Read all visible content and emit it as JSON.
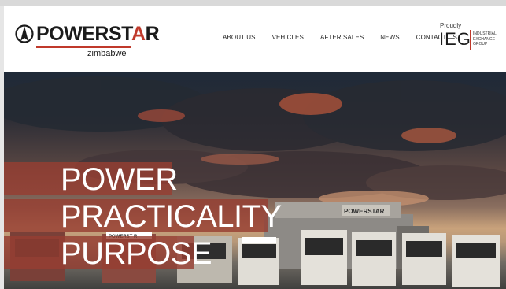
{
  "header": {
    "logo": {
      "brand_prefix": "POWERST",
      "brand_accent": "A",
      "brand_suffix": "R",
      "country": "zimbabwe"
    },
    "nav": [
      {
        "label": "ABOUT US"
      },
      {
        "label": "VEHICLES"
      },
      {
        "label": "AFTER SALES"
      },
      {
        "label": "NEWS"
      },
      {
        "label": "CONTACT US"
      }
    ],
    "partner": {
      "proudly": "Proudly",
      "mark": "IEG",
      "line1": "INDUSTRIAL",
      "line2": "EXCHANGE",
      "line3": "GROUP"
    }
  },
  "hero": {
    "headline": [
      "POWER",
      "PRACTICALITY",
      "PURPOSE"
    ],
    "building_sign": "POWERSTAR",
    "truck_sign": "POWERST R"
  },
  "colors": {
    "accent": "#c0392b",
    "headline_band": "#963e32",
    "nav_text": "#222222"
  }
}
